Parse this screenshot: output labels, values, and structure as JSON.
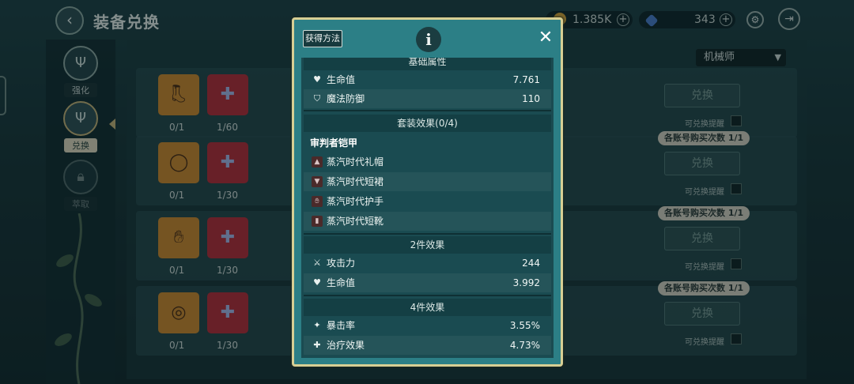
{
  "page": {
    "title": "装备兑换",
    "back_icon": "back-arrow-icon"
  },
  "currency": {
    "gold": {
      "value": "1.385K",
      "icon": "gold-coin-icon"
    },
    "gem": {
      "value": "343",
      "icon": "blue-gem-icon"
    }
  },
  "sidebar": {
    "items": [
      {
        "label": "强化",
        "icon": "trident-icon",
        "active": false
      },
      {
        "label": "兑换",
        "icon": "trident-icon",
        "active": true
      },
      {
        "label": "萃取",
        "icon": "lock-icon",
        "active": false
      }
    ]
  },
  "filter": {
    "job": "机械师"
  },
  "rows": [
    {
      "equip_count": "0/1",
      "mat_count": "1/60",
      "equip_icon": "boots-icon",
      "exchange_label": "兑换",
      "remind_label": "可兑换提醒",
      "limit": ""
    },
    {
      "equip_count": "0/1",
      "mat_count": "1/30",
      "equip_icon": "necklace-icon",
      "exchange_label": "兑换",
      "remind_label": "可兑换提醒",
      "limit": "各账号购买次数 1/1"
    },
    {
      "equip_count": "0/1",
      "mat_count": "1/30",
      "equip_icon": "gloves-icon",
      "exchange_label": "兑换",
      "remind_label": "可兑换提醒",
      "limit": "各账号购买次数 1/1"
    },
    {
      "equip_count": "0/1",
      "mat_count": "1/30",
      "equip_icon": "ring-icon",
      "exchange_label": "兑换",
      "remind_label": "可兑换提醒",
      "limit": "各账号购买次数 1/1"
    }
  ],
  "modal": {
    "how_to_get": "获得方法",
    "info_icon": "info-icon",
    "close_icon": "close-icon",
    "base_title": "基础属性",
    "base": [
      {
        "icon": "heart-icon",
        "label": "生命值",
        "value": "7.761"
      },
      {
        "icon": "shield-icon",
        "label": "魔法防御",
        "value": "110"
      }
    ],
    "set_title": "套装效果(0/4)",
    "set_name": "审判者铠甲",
    "pieces": [
      {
        "icon": "hat-icon",
        "label": "蒸汽时代礼帽"
      },
      {
        "icon": "skirt-icon",
        "label": "蒸汽时代短裙"
      },
      {
        "icon": "glove-icon",
        "label": "蒸汽时代护手"
      },
      {
        "icon": "boot-icon",
        "label": "蒸汽时代短靴"
      }
    ],
    "two_piece_title": "2件效果",
    "two_piece": [
      {
        "icon": "crossed-swords-icon",
        "label": "攻击力",
        "value": "244"
      },
      {
        "icon": "heart-icon",
        "label": "生命值",
        "value": "3.992"
      }
    ],
    "four_piece_title": "4件效果",
    "four_piece": [
      {
        "icon": "crit-icon",
        "label": "暴击率",
        "value": "3.55%"
      },
      {
        "icon": "heal-icon",
        "label": "治疗效果",
        "value": "4.73%"
      }
    ]
  }
}
